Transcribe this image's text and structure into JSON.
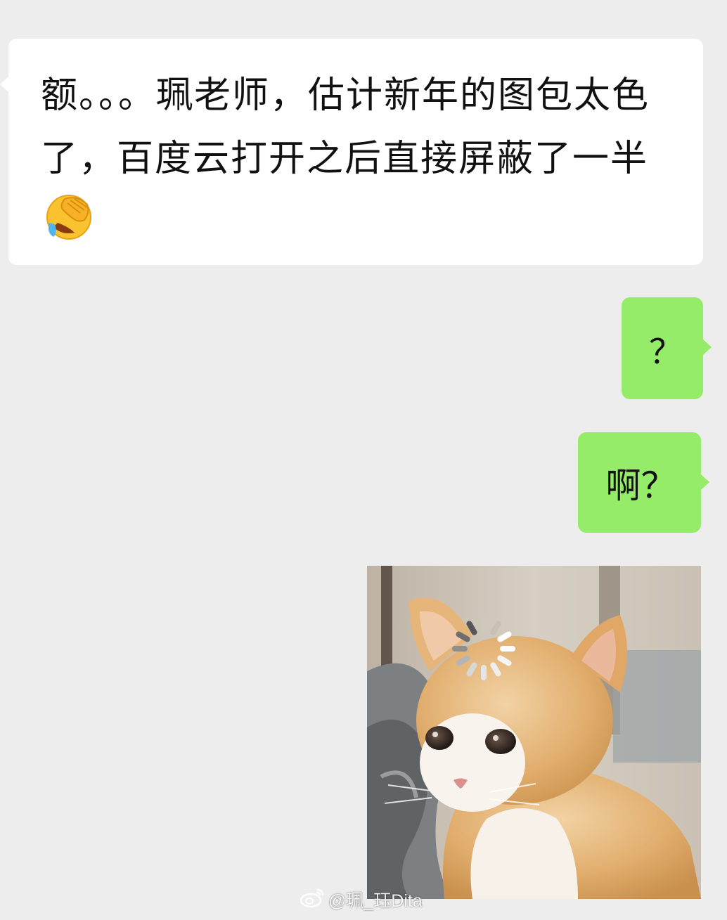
{
  "messages": [
    {
      "side": "incoming",
      "text": "额。。。珮老师，估计新年的图包太色了，百度云打开之后直接屏蔽了一半",
      "emoji": "face-palm-laughing-emoji"
    },
    {
      "side": "outgoing",
      "text": "？"
    },
    {
      "side": "outgoing",
      "text": "啊？"
    },
    {
      "side": "outgoing",
      "type": "sticker",
      "sticker": "confused-kitten-loading-sticker"
    }
  ],
  "watermark": {
    "icon": "weibo-logo-icon",
    "text": "@珮_珏Dita"
  },
  "colors": {
    "background": "#ededed",
    "incoming_bubble": "#ffffff",
    "outgoing_bubble": "#95ec69",
    "text": "#111111"
  }
}
